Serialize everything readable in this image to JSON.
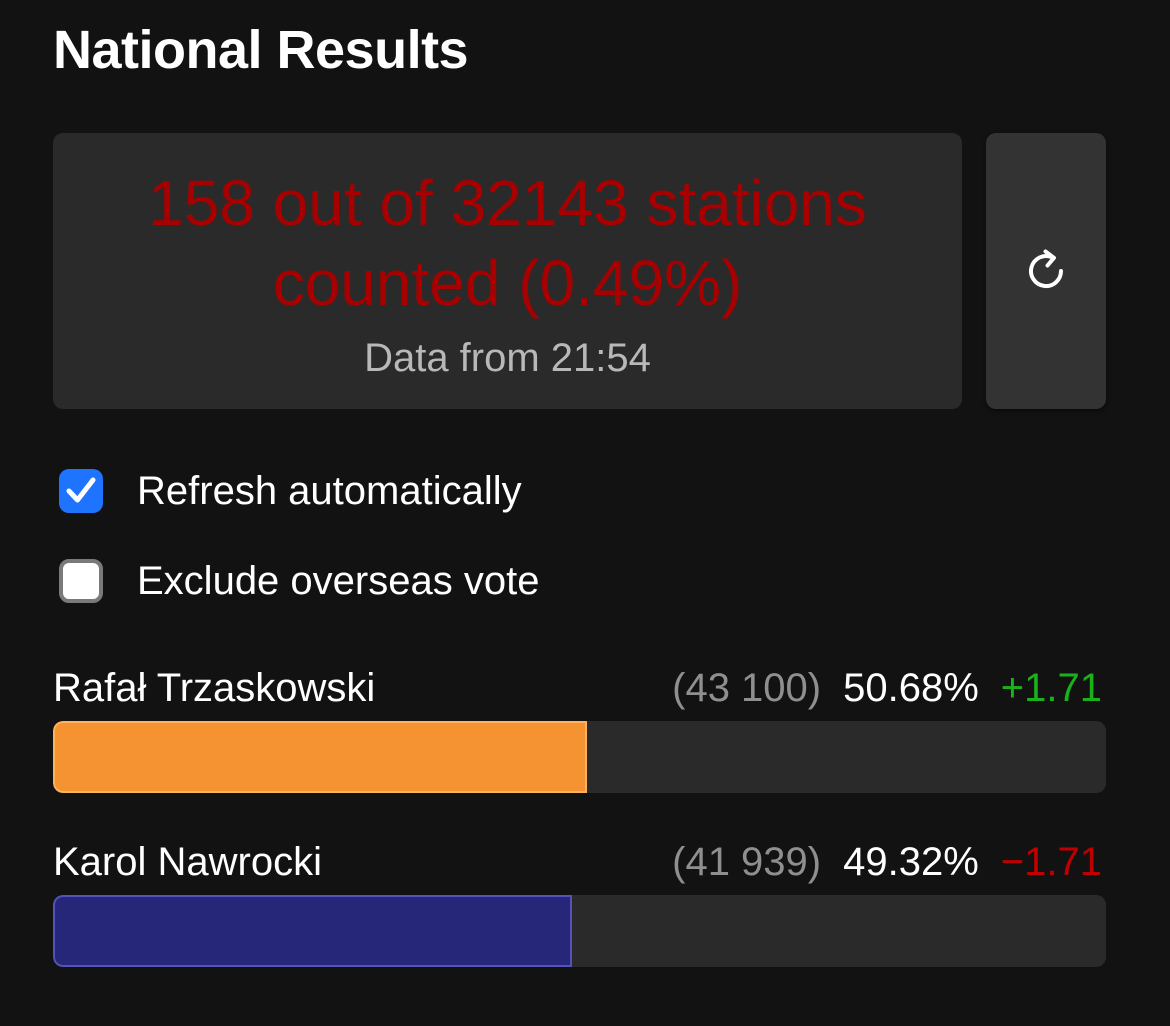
{
  "header": {
    "title": "National Results"
  },
  "status": {
    "count_text": "158 out of 32143 stations counted (0.49%)",
    "stations_counted": 158,
    "stations_total": 32143,
    "percent_counted": 0.49,
    "time_text": "Data from 21:54",
    "count_color": "#a60000"
  },
  "refresh": {
    "icon": "refresh-icon"
  },
  "options": {
    "auto_refresh": {
      "label": "Refresh automatically",
      "checked": true,
      "color": "#1e74ff"
    },
    "exclude_overseas": {
      "label": "Exclude overseas vote",
      "checked": false
    }
  },
  "candidates": [
    {
      "name": "Rafał Trzaskowski",
      "votes": "(43 100)",
      "percent": "50.68%",
      "share": 0.5068,
      "change": "+1.71",
      "color": "#f59332",
      "change_color": "#19b319"
    },
    {
      "name": "Karol Nawrocki",
      "votes": "(41 939)",
      "percent": "49.32%",
      "share": 0.4932,
      "change": "−1.71",
      "color": "#27277a",
      "change_color": "#c00000"
    }
  ]
}
